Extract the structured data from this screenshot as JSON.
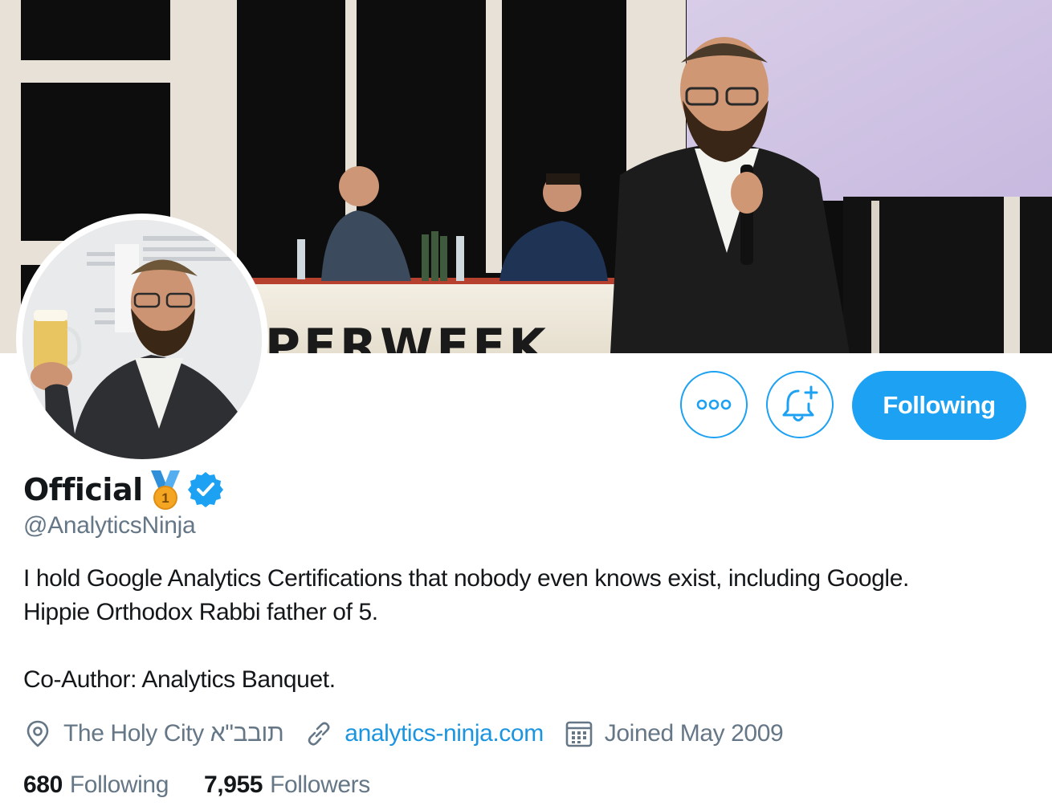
{
  "profile": {
    "display_name": "Official",
    "handle": "@AnalyticsNinja",
    "bio_lines": [
      "I hold Google Analytics Certifications that nobody even knows exist, including Google.",
      "Hippie Orthodox Rabbi father of 5.",
      "Co-Author:  Analytics Banquet."
    ],
    "location": "The Holy City תובב\"א",
    "website": "analytics-ninja.com",
    "joined": "Joined May 2009",
    "verified": true,
    "badge_icon": "first-place-medal-icon",
    "medal_number": "1"
  },
  "actions": {
    "more_icon": "more-dots-icon",
    "notify_icon": "bell-plus-icon",
    "follow_label": "Following"
  },
  "stats": {
    "following_count": "680",
    "following_label": "Following",
    "followers_count": "7,955",
    "followers_label": "Followers"
  },
  "banner": {
    "stage_text": "PERWEEK"
  },
  "colors": {
    "accent": "#1da1f2",
    "link": "#1b95e0",
    "secondary_text": "#657786",
    "primary_text": "#14171a"
  }
}
